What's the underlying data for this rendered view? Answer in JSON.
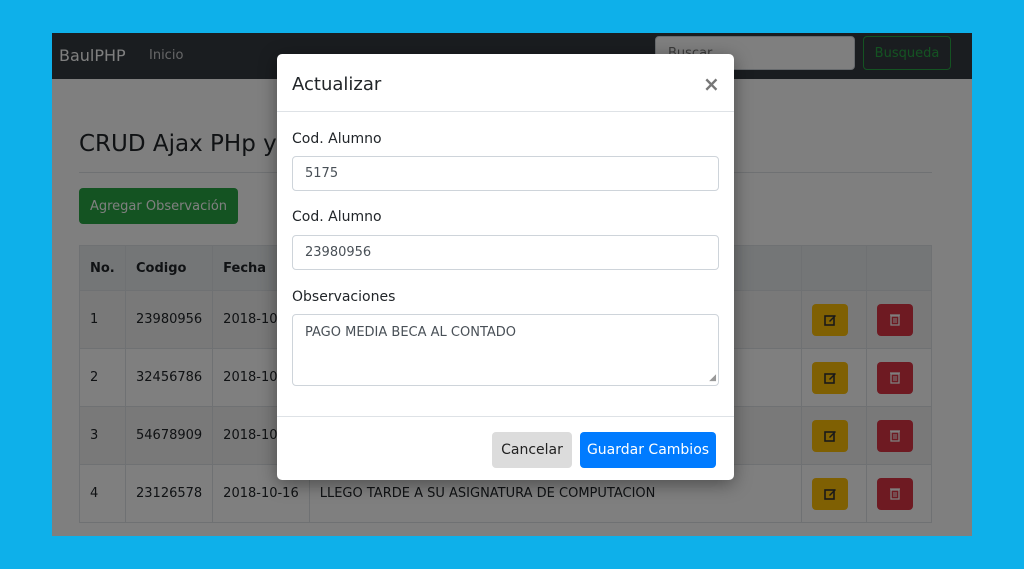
{
  "navbar": {
    "brand": "BaulPHP",
    "home": "Inicio",
    "search_placeholder": "Buscar",
    "search_button": "Busqueda"
  },
  "page": {
    "title": "CRUD Ajax PHp y",
    "add_button": "Agregar Observación"
  },
  "table": {
    "headers": [
      "No.",
      "Codigo",
      "Fecha"
    ],
    "rows": [
      {
        "no": "1",
        "codigo": "23980956",
        "fecha": "2018-10",
        "obs": ""
      },
      {
        "no": "2",
        "codigo": "32456786",
        "fecha": "2018-10",
        "obs": ""
      },
      {
        "no": "3",
        "codigo": "54678909",
        "fecha": "2018-10",
        "obs": ""
      },
      {
        "no": "4",
        "codigo": "23126578",
        "fecha": "2018-10-16",
        "obs": "LLEGO TARDE A SU ASIGNATURA DE COMPUTACION"
      }
    ]
  },
  "modal": {
    "title": "Actualizar",
    "close": "×",
    "label1": "Cod. Alumno",
    "value1": "5175",
    "label2": "Cod. Alumno",
    "value2": "23980956",
    "label3": "Observaciones",
    "value3": "PAGO MEDIA BECA AL CONTADO",
    "cancel": "Cancelar",
    "save": "Guardar Cambios"
  },
  "colors": {
    "accent": "#007bff",
    "success": "#28a745",
    "warning": "#ffc107",
    "danger": "#dc3545",
    "background": "#0eb0ea"
  }
}
